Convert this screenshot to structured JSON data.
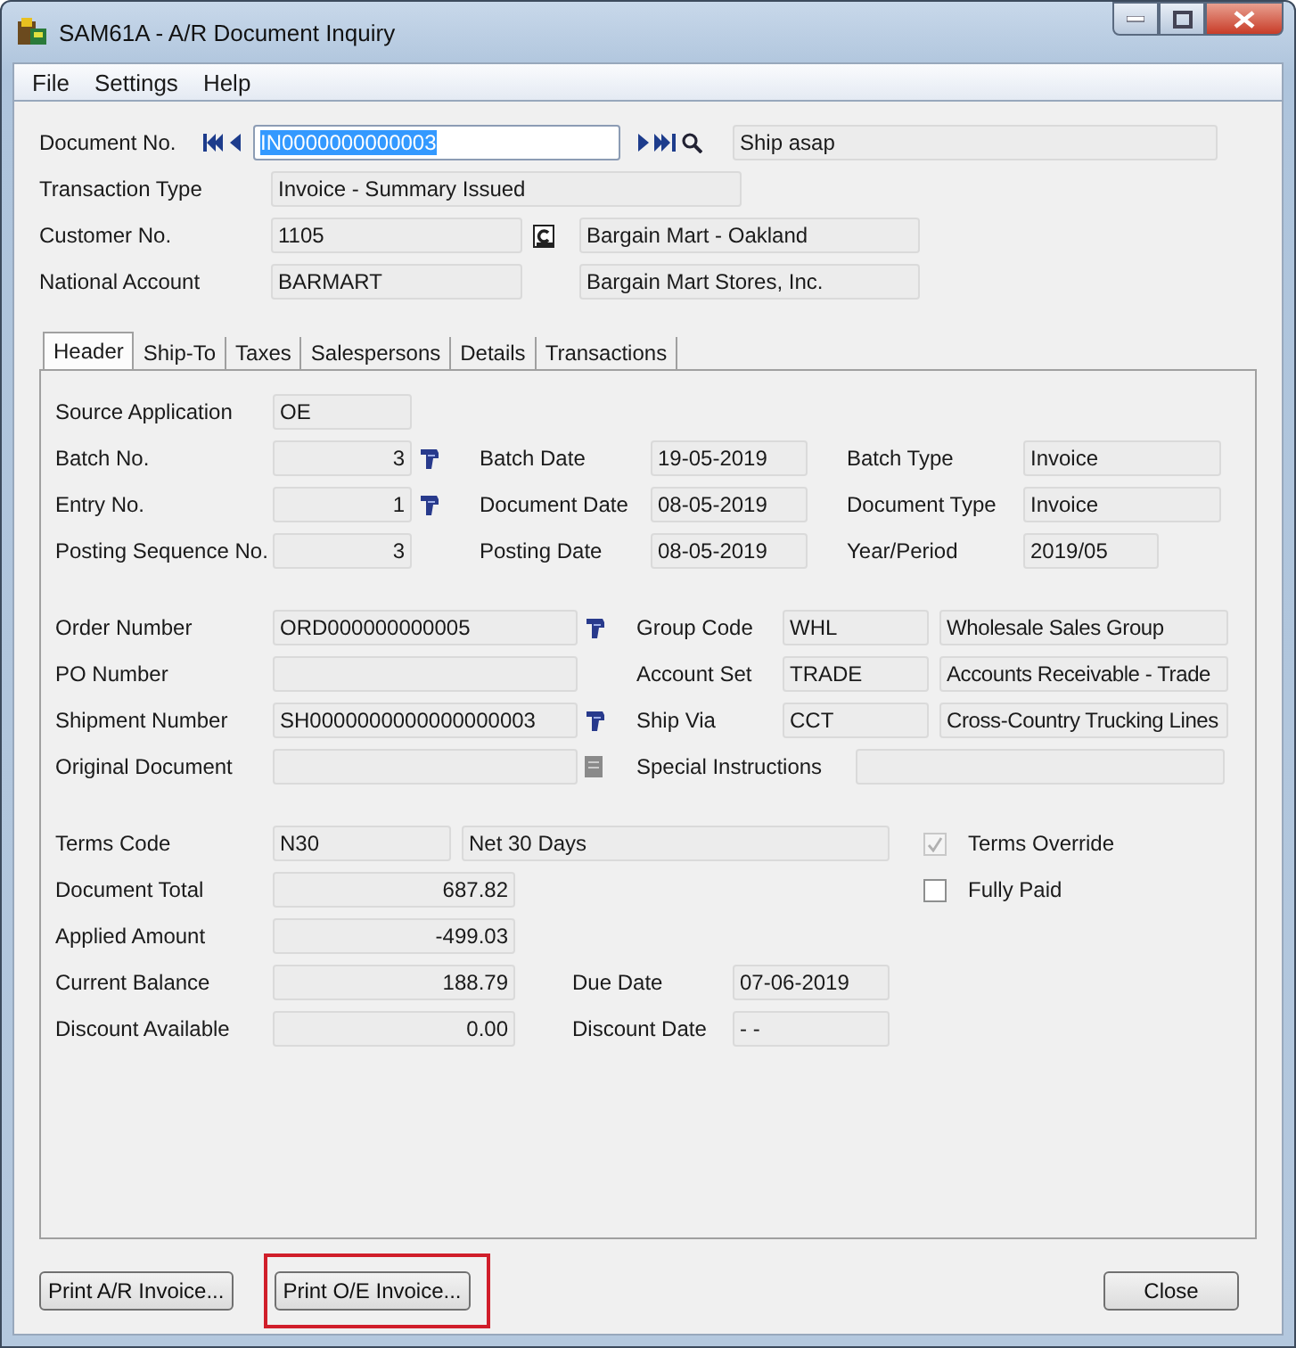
{
  "window": {
    "title": "SAM61A - A/R Document Inquiry"
  },
  "menu": [
    "File",
    "Settings",
    "Help"
  ],
  "header": {
    "document_no": {
      "label": "Document No.",
      "value": "IN0000000000003",
      "selected_text": true
    },
    "description": "Ship asap",
    "transaction_type": {
      "label": "Transaction Type",
      "value": "Invoice - Summary Issued"
    },
    "customer": {
      "label": "Customer No.",
      "value": "1105",
      "name": "Bargain Mart - Oakland"
    },
    "national_account": {
      "label": "National Account",
      "value": "BARMART",
      "name": "Bargain Mart Stores, Inc."
    }
  },
  "tabs": [
    {
      "label": "Header",
      "selected": true
    },
    {
      "label": "Ship-To",
      "selected": false
    },
    {
      "label": "Taxes",
      "selected": false
    },
    {
      "label": "Salespersons",
      "selected": false
    },
    {
      "label": "Details",
      "selected": false
    },
    {
      "label": "Transactions",
      "selected": false
    }
  ],
  "source_application": {
    "label": "Source Application",
    "value": "OE"
  },
  "batch_rows": [
    {
      "label": "Batch No.",
      "value": "3",
      "drilldown": true,
      "label_2": "Batch Date",
      "value_2": "19-05-2019",
      "label_3": "Batch Type",
      "value_3": "Invoice"
    },
    {
      "label": "Entry No.",
      "value": "1",
      "drilldown": true,
      "label_2": "Document Date",
      "value_2": "08-05-2019",
      "label_3": "Document Type",
      "value_3": "Invoice"
    },
    {
      "label": "Posting Sequence No.",
      "value": "3",
      "drilldown": false,
      "label_2": "Posting Date",
      "value_2": "08-05-2019",
      "label_3": "Year/Period",
      "value_3": "2019/05"
    }
  ],
  "order_rows": [
    {
      "label": "Order Number",
      "value": "ORD000000000005",
      "drilldown": true,
      "label_2": "Group Code",
      "value_2": "WHL",
      "value_3": "Wholesale Sales Group"
    },
    {
      "label": "PO Number",
      "drilldown": false,
      "label_2": "Account Set",
      "value_2": "TRADE",
      "value_3": "Accounts Receivable - Trade"
    },
    {
      "label": "Shipment Number",
      "value": "SH0000000000000000003",
      "drilldown": true,
      "label_2": "Ship Via",
      "value_2": "CCT",
      "value_3": "Cross-Country Trucking Lines"
    }
  ],
  "original_document": {
    "label": "Original Document",
    "label_2": "Special Instructions"
  },
  "terms": {
    "label": "Terms Code",
    "value": "N30",
    "description": "Net 30 Days"
  },
  "amount_rows": [
    {
      "label": "Document Total",
      "value": "687.82"
    },
    {
      "label": "Applied Amount",
      "value": "-499.03"
    },
    {
      "label": "Current Balance",
      "value": "188.79",
      "label_2": "Due Date",
      "value_2": "07-06-2019"
    },
    {
      "label": "Discount Available",
      "value": "0.00",
      "label_2": "Discount Date",
      "value_2": "-  -"
    }
  ],
  "checkboxes": [
    {
      "label": "Terms Override",
      "checked": true,
      "disabled": true
    },
    {
      "label": "Fully Paid",
      "checked": false,
      "disabled": false
    }
  ],
  "buttons": [
    {
      "label": "Print A/R Invoice...",
      "highlighted": false
    },
    {
      "label": "Print O/E Invoice...",
      "highlighted": true
    }
  ],
  "close_button": "Close"
}
